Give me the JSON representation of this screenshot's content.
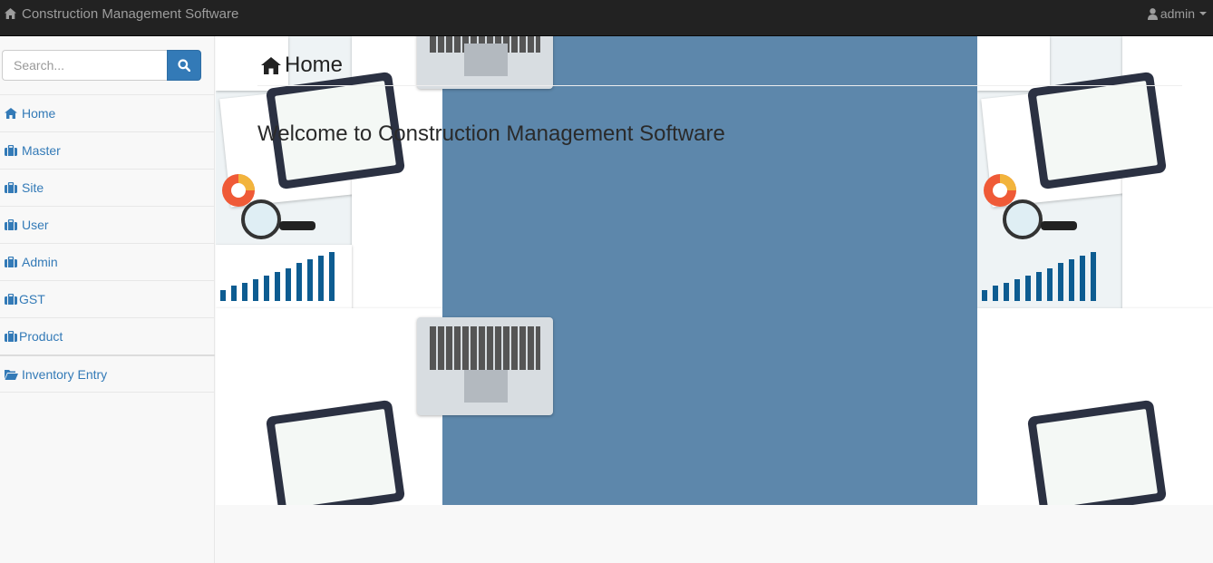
{
  "navbar": {
    "brand": "Construction Management Software",
    "user": "admin"
  },
  "search": {
    "placeholder": "Search..."
  },
  "sidebar": {
    "items": [
      {
        "label": "Home",
        "icon": "home-icon"
      },
      {
        "label": "Master",
        "icon": "briefcase-icon"
      },
      {
        "label": "Site",
        "icon": "briefcase-icon"
      },
      {
        "label": "User",
        "icon": "briefcase-icon"
      },
      {
        "label": "Admin",
        "icon": "briefcase-icon"
      },
      {
        "label": "GST",
        "icon": "briefcase-icon"
      },
      {
        "label": "Product",
        "icon": "briefcase-icon"
      },
      {
        "label": "Inventory Entry",
        "icon": "folder-open-icon"
      }
    ]
  },
  "main": {
    "title": "Home",
    "welcome": "Welcome to Construction Management Software"
  },
  "colors": {
    "navbar_bg": "#222222",
    "link": "#337ab7",
    "hero_bg": "#5d87ab"
  }
}
